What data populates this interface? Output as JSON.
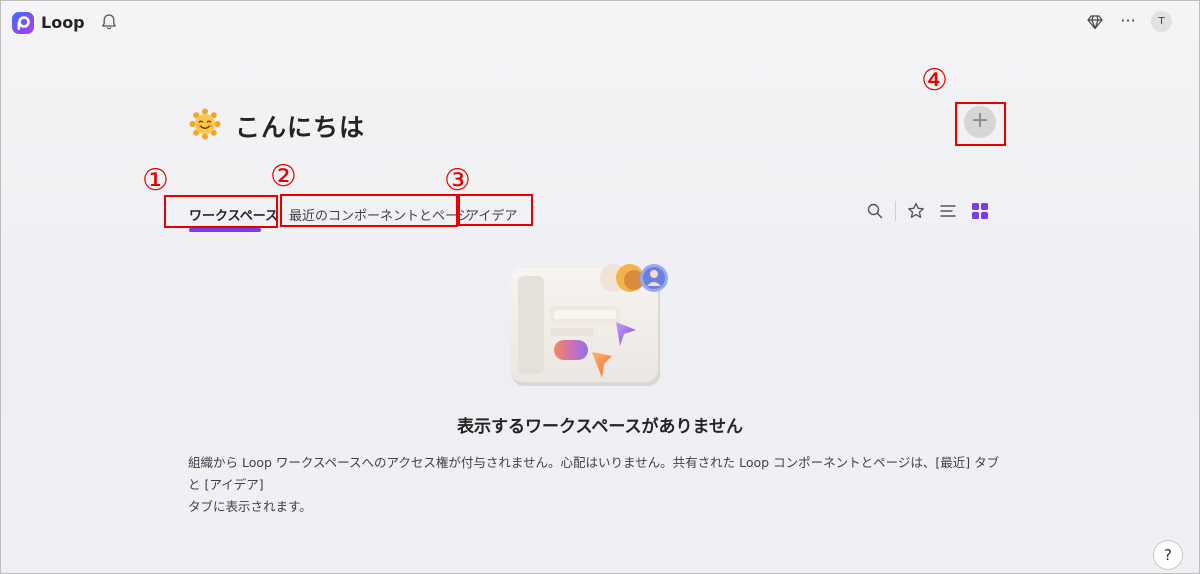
{
  "app": {
    "name": "Loop"
  },
  "header": {
    "more_label": "···",
    "avatar_initial": "T"
  },
  "greeting": {
    "text": "こんにちは"
  },
  "tabs": [
    {
      "label": "ワークスペース",
      "active": true
    },
    {
      "label": "最近のコンポーネントとページ",
      "active": false
    },
    {
      "label": "アイデア",
      "active": false
    }
  ],
  "annotations": [
    "①",
    "②",
    "③",
    "④"
  ],
  "add_button": {
    "label": "+"
  },
  "empty_state": {
    "title": "表示するワークスペースがありません",
    "description_line1": "組織から Loop ワークスペースへのアクセス権が付与されません。心配はいりません。共有された Loop コンポーネントとページは、[最近] タブと [アイデア]",
    "description_line2": "タブに表示されます。"
  },
  "help": {
    "label": "?"
  },
  "colors": {
    "accent": "#7a3ce6",
    "annotation": "#e60000"
  },
  "icons": [
    "loop-logo-icon",
    "bell-icon",
    "diamond-icon",
    "more-icon",
    "search-icon",
    "star-icon",
    "list-view-icon",
    "grid-view-icon",
    "help-icon"
  ]
}
